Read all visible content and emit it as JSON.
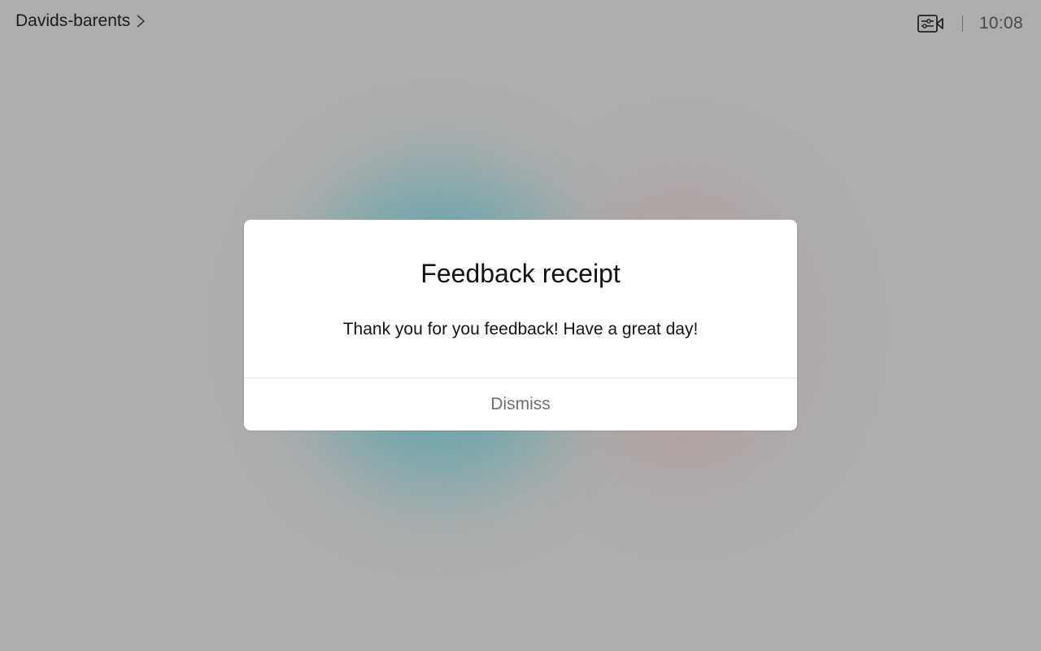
{
  "header": {
    "room_name": "Davids-barents",
    "chevron_icon": "chevron-right-icon",
    "camera_controls_icon": "camera-controls-icon",
    "separator": "|",
    "time": "10:08"
  },
  "dialog": {
    "title": "Feedback receipt",
    "message": "Thank you for you feedback! Have a great day!",
    "dismiss_label": "Dismiss"
  },
  "colors": {
    "background": "#adadad",
    "blob_teal": "#3ca0a5",
    "blob_pink": "#be8c8c",
    "dialog_bg": "#ffffff",
    "dismiss_text": "#6e6e6e"
  }
}
